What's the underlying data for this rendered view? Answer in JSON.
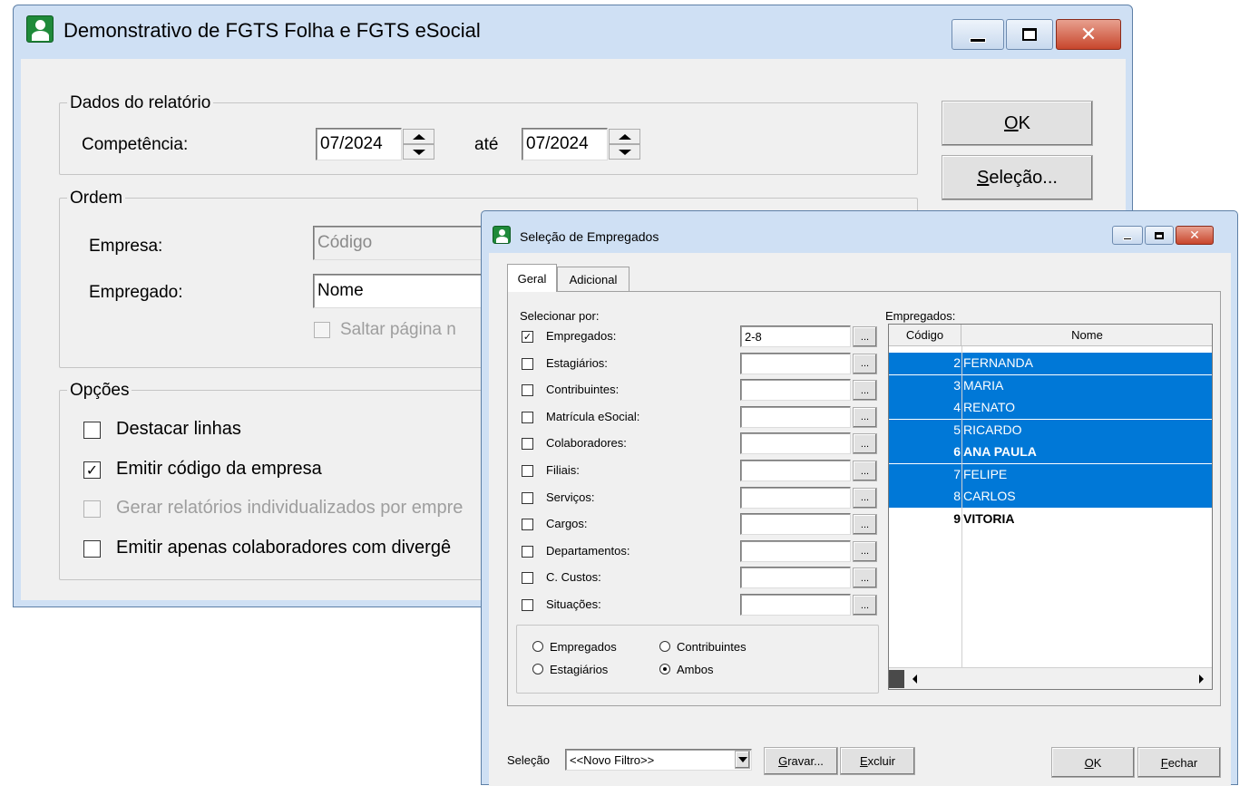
{
  "main_window": {
    "title": "Demonstrativo de FGTS Folha e FGTS eSocial",
    "dados_group_label": "Dados do relatório",
    "competencia_label": "Competência:",
    "competencia_from": "07/2024",
    "ate_label": "até",
    "competencia_to": "07/2024",
    "ordem_group_label": "Ordem",
    "empresa_label": "Empresa:",
    "empresa_value": "Código",
    "empregado_label": "Empregado:",
    "empregado_value": "Nome",
    "saltar_label": "Saltar página n",
    "opcoes_group_label": "Opções",
    "options": [
      {
        "label": "Destacar linhas",
        "checked": false,
        "enabled": true
      },
      {
        "label": "Emitir código da empresa",
        "checked": true,
        "enabled": true
      },
      {
        "label": "Gerar relatórios individualizados por empre",
        "checked": false,
        "enabled": false
      },
      {
        "label": "Emitir apenas colaboradores com divergê",
        "checked": false,
        "enabled": true
      }
    ],
    "ok_hotkey": "O",
    "ok_rest": "K",
    "selecao_hotkey": "S",
    "selecao_rest": "eleção..."
  },
  "selection_dialog": {
    "title": "Seleção de Empregados",
    "tabs": [
      "Geral",
      "Adicional"
    ],
    "selecionar_por_label": "Selecionar por:",
    "criteria": [
      {
        "label": "Empregados:",
        "checked": true,
        "value": "2-8"
      },
      {
        "label": "Estagiários:",
        "checked": false,
        "value": ""
      },
      {
        "label": "Contribuintes:",
        "checked": false,
        "value": ""
      },
      {
        "label": "Matrícula eSocial:",
        "checked": false,
        "value": ""
      },
      {
        "label": "Colaboradores:",
        "checked": false,
        "value": ""
      },
      {
        "label": "Filiais:",
        "checked": false,
        "value": ""
      },
      {
        "label": "Serviços:",
        "checked": false,
        "value": ""
      },
      {
        "label": "Cargos:",
        "checked": false,
        "value": ""
      },
      {
        "label": "Departamentos:",
        "checked": false,
        "value": ""
      },
      {
        "label": "C. Custos:",
        "checked": false,
        "value": ""
      },
      {
        "label": "Situações:",
        "checked": false,
        "value": ""
      }
    ],
    "browse_label": "...",
    "radio_options": [
      {
        "label": "Empregados",
        "selected": false
      },
      {
        "label": "Contribuintes",
        "selected": false
      },
      {
        "label": "Estagiários",
        "selected": false
      },
      {
        "label": "Ambos",
        "selected": true
      }
    ],
    "empregados_label": "Empregados:",
    "columns": [
      "Código",
      "Nome"
    ],
    "rows": [
      {
        "code": "2",
        "name": "FERNANDA",
        "selected": true,
        "bold": false
      },
      {
        "code": "3",
        "name": "MARIA",
        "selected": true,
        "bold": false
      },
      {
        "code": "4",
        "name": "RENATO",
        "selected": true,
        "bold": false
      },
      {
        "code": "5",
        "name": "RICARDO",
        "selected": true,
        "bold": false
      },
      {
        "code": "6",
        "name": "ANA PAULA",
        "selected": true,
        "bold": true
      },
      {
        "code": "7",
        "name": "FELIPE",
        "selected": true,
        "bold": false
      },
      {
        "code": "8",
        "name": "CARLOS",
        "selected": true,
        "bold": false
      },
      {
        "code": "9",
        "name": "VITORIA",
        "selected": false,
        "bold": true
      }
    ],
    "selecao_label": "Seleção",
    "filter_value": "<<Novo Filtro>>",
    "gravar_hotkey": "G",
    "gravar_rest": "ravar...",
    "excluir_hotkey": "E",
    "excluir_rest": "xcluir",
    "ok_hotkey": "O",
    "ok_rest": "K",
    "fechar_hotkey": "F",
    "fechar_rest": "echar"
  },
  "colors": {
    "selection_blue": "#0078d7",
    "window_frame": "#cfe0f4",
    "close_red": "#c8462c"
  }
}
